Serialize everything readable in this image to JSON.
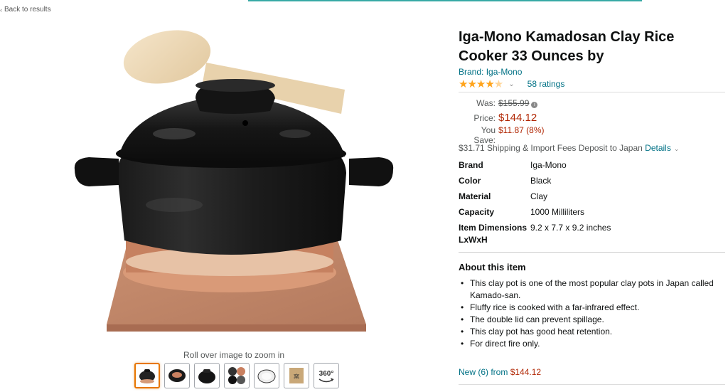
{
  "nav": {
    "back_label": "Back to results"
  },
  "gallery": {
    "zoom_hint": "Roll over image to zoom in",
    "thumbnails": [
      "thumbnail-1",
      "thumbnail-2",
      "thumbnail-3",
      "thumbnail-4",
      "thumbnail-5",
      "thumbnail-6",
      "thumbnail-360"
    ],
    "view360_label": "360°"
  },
  "product": {
    "title": "Iga-Mono Kamadosan Clay Rice Cooker 33 Ounces by",
    "brand_link": "Brand: Iga-Mono",
    "rating_stars": 4.5,
    "ratings_count": "58 ratings"
  },
  "pricing": {
    "was_label": "Was:",
    "was_value": "$155.99",
    "price_label": "Price:",
    "price_value": "$144.12",
    "save_label": "You Save:",
    "save_value": "$11.87 (8%)",
    "shipping_text": "$31.71 Shipping & Import Fees Deposit to Japan",
    "details_label": "Details"
  },
  "specs": [
    {
      "key": "Brand",
      "value": "Iga-Mono"
    },
    {
      "key": "Color",
      "value": "Black"
    },
    {
      "key": "Material",
      "value": "Clay"
    },
    {
      "key": "Capacity",
      "value": "1000 Milliliters"
    },
    {
      "key": "Item Dimensions LxWxH",
      "value": "9.2 x 7.7 x 9.2 inches"
    }
  ],
  "about": {
    "title": "About this item",
    "bullets": [
      "This clay pot is one of the most popular clay pots in Japan called Kamado-san.",
      "Fluffy rice is cooked with a far-infrared effect.",
      "The double lid can prevent spillage.",
      "This clay pot has good heat retention.",
      "For direct fire only."
    ]
  },
  "offers": {
    "new_label": "New (6) from",
    "new_price": "$144.12"
  },
  "colors": {
    "link": "#007185",
    "price": "#b12704",
    "star": "#ffa41c",
    "thumb_active": "#e77600"
  }
}
